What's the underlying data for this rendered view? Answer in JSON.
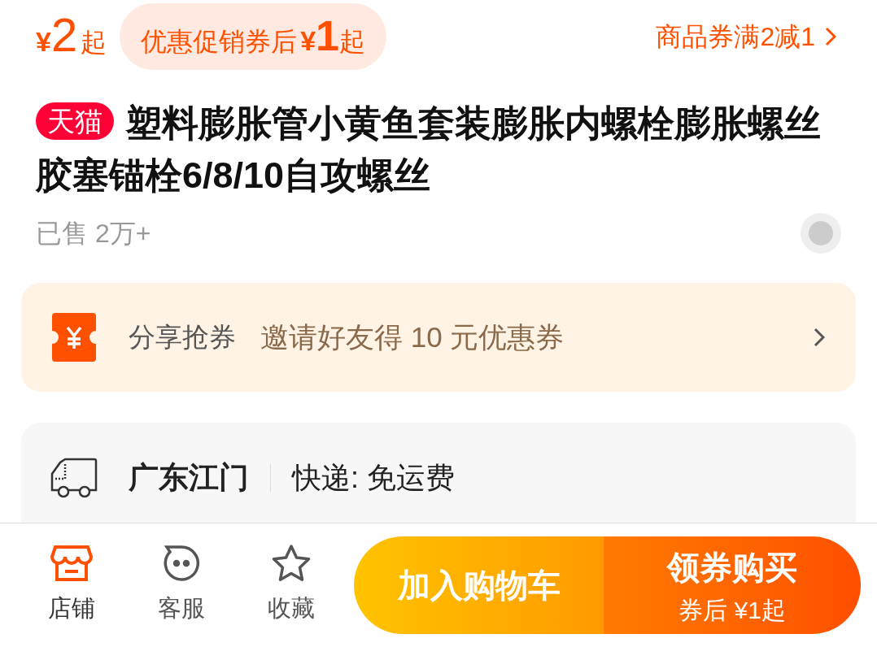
{
  "price": {
    "currency": "¥",
    "amount": "2",
    "suffix": "起"
  },
  "promo_pill": {
    "label": "优惠促销券后",
    "currency": "¥",
    "amount": "1",
    "suffix": "起"
  },
  "coupon_link": {
    "label": "商品券满2减1"
  },
  "product": {
    "badge": "天猫",
    "title": "塑料膨胀管小黄鱼套装膨胀内螺栓膨胀螺丝胶塞锚栓6/8/10自攻螺丝",
    "sold": "已售 2万+"
  },
  "share_card": {
    "label": "分享抢券",
    "text": "邀请好友得 10 元优惠券"
  },
  "shipping": {
    "origin": "广东江门",
    "method": "快递: 免运费"
  },
  "bottom_bar": {
    "nav": [
      {
        "label": "店铺",
        "kind": "store",
        "selected": true
      },
      {
        "label": "客服",
        "kind": "chat",
        "selected": false
      },
      {
        "label": "收藏",
        "kind": "star",
        "selected": false
      }
    ],
    "add_to_cart": "加入购物车",
    "buy": {
      "label": "领券购买",
      "sub": "券后 ¥1起"
    }
  }
}
